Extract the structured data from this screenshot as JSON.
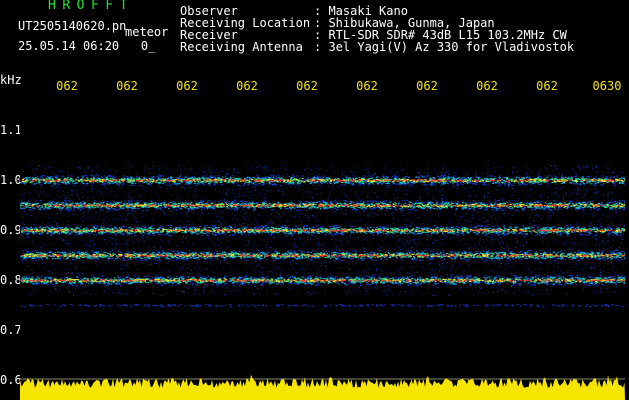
{
  "header": {
    "title": "HROFFT",
    "filename": "UT2505140620.pn",
    "meteor_label": "meteor",
    "timestamp": "25.05.14 06:20   0_",
    "info_rows": [
      {
        "key": "Observer",
        "value": ": Masaki Kano"
      },
      {
        "key": "Receiving Location",
        "value": ": Shibukawa, Gunma, Japan"
      },
      {
        "key": "Receiver",
        "value": ": RTL-SDR SDR# 43dB L15 103.2MHz CW"
      },
      {
        "key": "Receiving Antenna",
        "value": ": 3el Yagi(V) Az 330 for Vladivostok"
      }
    ]
  },
  "colors": {
    "title": "#22e22e",
    "minute_labels": "#f2e21a",
    "amplitude_strip": "#f5e500",
    "band_core": "#ff2a2a"
  },
  "chart_data": {
    "type": "heatmap",
    "yunit": "kHz",
    "y_ticks": [
      "1.1",
      "1.0",
      "0.9",
      "0.8",
      "0.7",
      "0.6"
    ],
    "x_ticks": [
      "062",
      "062",
      "062",
      "062",
      "062",
      "062",
      "062",
      "062",
      "062",
      "0630"
    ],
    "ylim": [
      0.6,
      1.15
    ],
    "band_centers_khz": [
      1.0,
      0.95,
      0.9,
      0.85,
      0.8
    ],
    "faint_line_khz": 0.75
  }
}
